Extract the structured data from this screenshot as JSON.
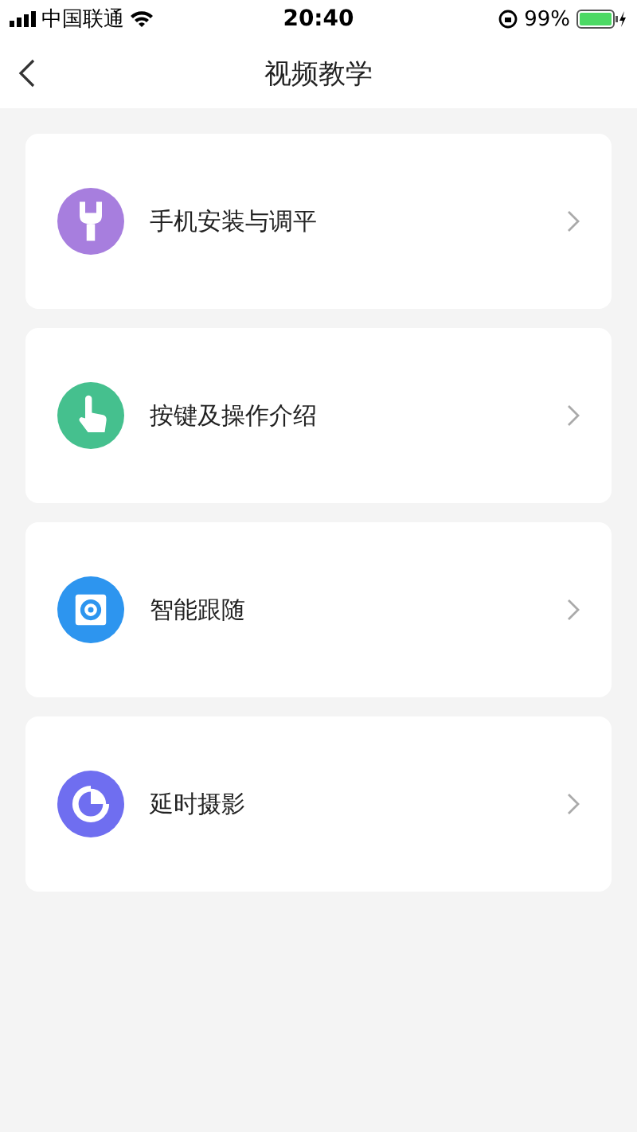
{
  "status_bar": {
    "carrier": "中国联通",
    "time": "20:40",
    "battery": "99%"
  },
  "nav": {
    "title": "视频教学"
  },
  "items": [
    {
      "label": "手机安装与调平",
      "kind": "wrench",
      "color": "#a77ede"
    },
    {
      "label": "按键及操作介绍",
      "kind": "hand",
      "color": "#45c08e"
    },
    {
      "label": "智能跟随",
      "kind": "camera",
      "color": "#2d95ef"
    },
    {
      "label": "延时摄影",
      "kind": "timer",
      "color": "#6f6ef0"
    }
  ]
}
